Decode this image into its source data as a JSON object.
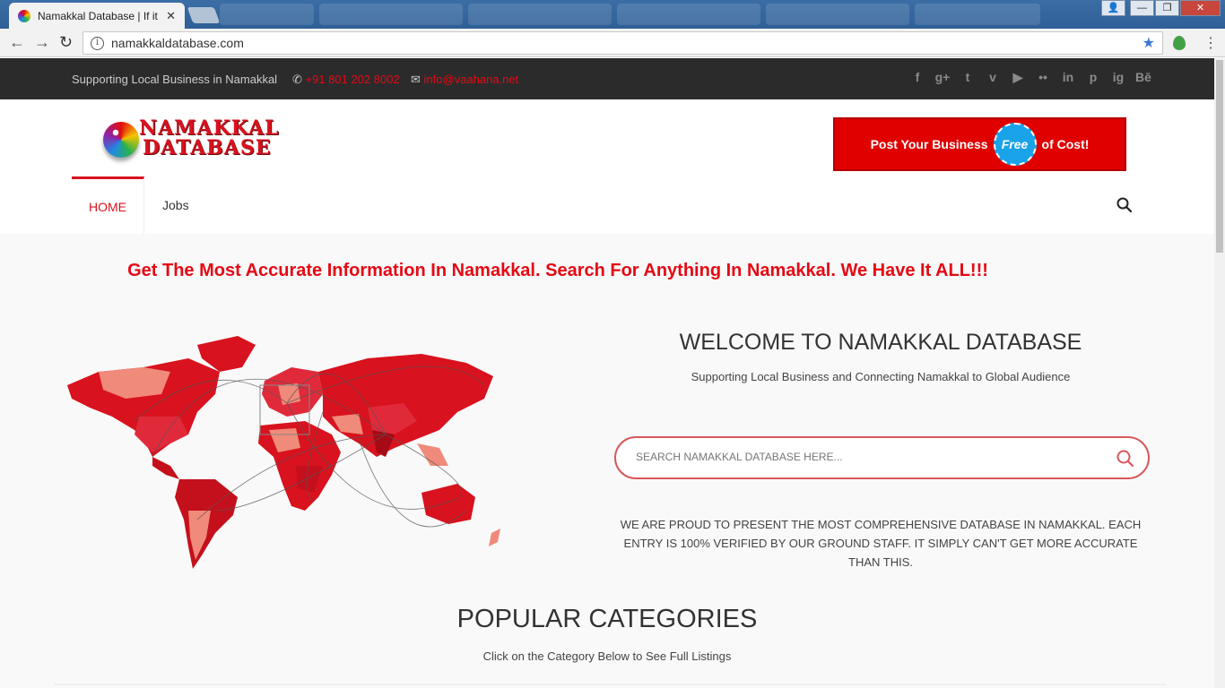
{
  "browser": {
    "tab_title": "Namakkal Database | If it",
    "tab_close": "✕",
    "url": "namakkaldatabase.com",
    "back": "←",
    "forward": "→",
    "reload": "↻",
    "info": "i",
    "star": "★",
    "menu": "⋮"
  },
  "topbar": {
    "tagline": "Supporting Local Business in Namakkal",
    "phone": "+91 801 202 8002",
    "email": "info@vaahana.net",
    "phone_icon": "✆",
    "email_icon": "✉",
    "social": [
      "f",
      "g+",
      "t",
      "v",
      "▶",
      "••",
      "in",
      "p",
      "ig",
      "Bē"
    ]
  },
  "header": {
    "logo_line1": "NAMAKKAL",
    "logo_line2": "DATABASE",
    "promo_left": "Post Your Business",
    "promo_badge": "Free",
    "promo_right": "of Cost!"
  },
  "nav": {
    "home": "HOME",
    "jobs": "Jobs"
  },
  "hero": {
    "headline": "Get The Most Accurate Information In Namakkal. Search For Anything In Namakkal. We Have It ALL!!!",
    "welcome_title": "WELCOME TO NAMAKKAL DATABASE",
    "welcome_sub": "Supporting Local Business and Connecting Namakkal to Global Audience",
    "search_placeholder": "SEARCH NAMAKKAL DATABASE HERE...",
    "proud_text": "WE ARE PROUD TO PRESENT THE MOST COMPREHENSIVE DATABASE IN NAMAKKAL. EACH ENTRY IS 100% VERIFIED BY OUR GROUND STAFF. IT SIMPLY CAN'T GET MORE ACCURATE THAN THIS."
  },
  "categories": {
    "title": "POPULAR CATEGORIES",
    "subtitle": "Click on the Category Below to See Full Listings"
  },
  "colors": {
    "accent": "#e50914",
    "topbar_bg": "#2b2b2b",
    "promo_bg": "#e00000",
    "badge": "#1aa3e8"
  }
}
